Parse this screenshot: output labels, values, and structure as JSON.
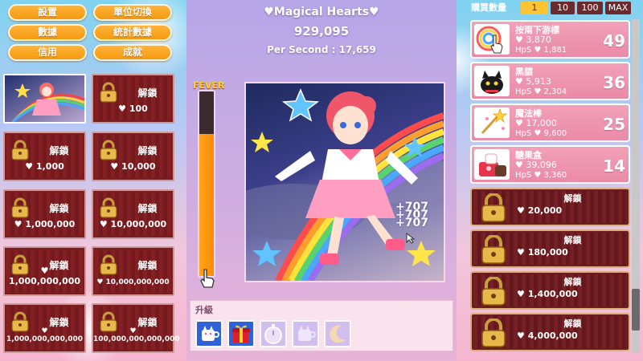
{
  "menu": {
    "settings": "設置",
    "unit_switch": "單位切換",
    "data": "數據",
    "stats": "統計數據",
    "mail": "信用",
    "achievements": "成就"
  },
  "grid": {
    "cards": [
      {
        "title": "",
        "cost": "",
        "unlocked": true
      },
      {
        "title": "解鎖",
        "cost": "100"
      },
      {
        "title": "解鎖",
        "cost": "1,000"
      },
      {
        "title": "解鎖",
        "cost": "10,000"
      },
      {
        "title": "解鎖",
        "cost": "1,000,000"
      },
      {
        "title": "解鎖",
        "cost": "10,000,000"
      },
      {
        "title": "解鎖",
        "cost": "1,000,000,000"
      },
      {
        "title": "解鎖",
        "cost": "10,000,000,000"
      },
      {
        "title": "解鎖",
        "cost": "1,000,000,000,000"
      },
      {
        "title": "解鎖",
        "cost": "100,000,000,000,000"
      }
    ]
  },
  "score": {
    "title": "Magical Hearts",
    "value": "929,095",
    "per_second": "Per Second : 17,659"
  },
  "fever": {
    "label": "FEVER",
    "level_percent": 77
  },
  "floating": [
    "+707",
    "+707",
    "+707"
  ],
  "upgrades": {
    "label": "升級",
    "items": [
      {
        "icon": "cat-cup-icon",
        "state": "active"
      },
      {
        "icon": "gift-icon",
        "state": "active"
      },
      {
        "icon": "pocket-watch-icon",
        "state": "locked"
      },
      {
        "icon": "cat-cup-icon",
        "state": "locked"
      },
      {
        "icon": "moon-icon",
        "state": "locked"
      }
    ]
  },
  "quantity": {
    "label": "購買數量",
    "options": [
      "1",
      "10",
      "100",
      "MAX"
    ],
    "selected": "1"
  },
  "shop": {
    "items": [
      {
        "name": "按兩下游標",
        "cost": "3,870",
        "hps": "HpS ♥ 1,881",
        "count": "49"
      },
      {
        "name": "黑貓",
        "cost": "5,913",
        "hps": "HpS ♥ 2,304",
        "count": "36"
      },
      {
        "name": "魔法棒",
        "cost": "17,000",
        "hps": "HpS ♥ 9,600",
        "count": "25"
      },
      {
        "name": "糖果盒",
        "cost": "39,096",
        "hps": "HpS ♥ 3,360",
        "count": "14"
      }
    ],
    "locked": [
      {
        "title": "解鎖",
        "cost": "20,000"
      },
      {
        "title": "解鎖",
        "cost": "180,000"
      },
      {
        "title": "解鎖",
        "cost": "1,400,000"
      },
      {
        "title": "解鎖",
        "cost": "4,000,000"
      }
    ]
  },
  "colors": {
    "menu_orange": "#f5a020",
    "card_red": "#7a1c20",
    "shop_pink": "#ee93ad",
    "fever_orange": "#ff9a12"
  }
}
